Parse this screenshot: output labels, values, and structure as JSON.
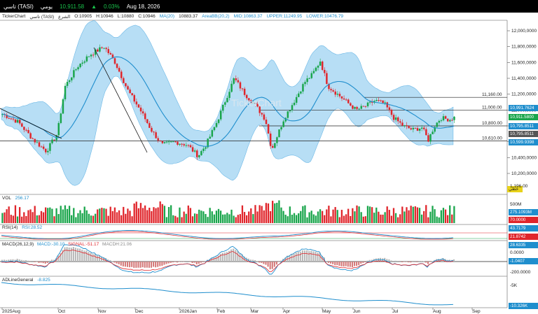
{
  "topbar": {
    "symbol": "تاسي (TASI)",
    "market": "يومي",
    "price": "10,911.58",
    "change_pct": "0.03%",
    "date": "Aug 18, 2026"
  },
  "infobar": {
    "app": "TickerChart",
    "symbol": "تاسي (TASI)",
    "type": "الشرع",
    "open": "O:10905",
    "high": "H:10946",
    "low": "L:10880",
    "close": "C:10946",
    "ma": "MA(20)",
    "ma_val": "10883.37",
    "bb": "AreaBB(20,2)",
    "bb_mid": "MID:10863.37",
    "bb_upper": "UPPER:11249.95",
    "bb_lower": "LOWER:10476.79"
  },
  "price_axis": {
    "ticks": [
      "12,000,0000",
      "11,800,0000",
      "11,600,0000",
      "11,400,0000",
      "11,200,0000",
      "11,000,0000",
      "10,800,0000",
      "10,600,0000",
      "10,400,0000",
      "10,200,0000"
    ],
    "bottom_value": "1,196.00"
  },
  "levels": [
    {
      "label": "11,160.00",
      "value": 11160
    },
    {
      "label": "11,000.00",
      "value": 11000
    },
    {
      "label": "10,800.00",
      "value": 10800
    },
    {
      "label": "10,610.00",
      "value": 10610
    }
  ],
  "price_tags": [
    {
      "text": "10,991.7624",
      "color": "#1f8ecd"
    },
    {
      "text": "10,911.5800",
      "color": "#19a54b"
    },
    {
      "text": "10,795.8511",
      "color": "#1f8ecd"
    },
    {
      "text": "10,795.8511",
      "color": "#555555"
    },
    {
      "text": "10,599.9398",
      "color": "#1f8ecd"
    }
  ],
  "last_label_box": "خطي",
  "volume": {
    "label": "VOL",
    "value": "256.17",
    "axis_top": "500M",
    "tag1": "275.1093M",
    "tag2": "70.0000"
  },
  "rsi": {
    "label": "RSI(14)",
    "value": "RSI:28.52",
    "tag1": "43.7179",
    "tag2": "21.8742",
    "tag3": "28.6335"
  },
  "macd": {
    "label": "MACD(26,12,9)",
    "macd": "MACD:-30.10",
    "signal": "SIGNAL:-51.17",
    "hist": "MACDH:21.06",
    "tag1": "0.0000",
    "tag2": "-1.0407",
    "axis_bottom": "-200.0000"
  },
  "adline": {
    "label": "ADLineGeneral",
    "value": "-8.825",
    "axis_top": "-5K",
    "tag": "-10.326K"
  },
  "x_axis": [
    "2025Aug",
    "Oct",
    "Nov",
    "Dec",
    "2026Jan",
    "Feb",
    "Mar",
    "Apr",
    "May",
    "Jun",
    "Jul",
    "Aug",
    "Sep"
  ],
  "colors": {
    "up": "#19a54b",
    "down": "#e0252b",
    "band": "#9fd3f2",
    "ma": "#1f8ecd"
  },
  "watermark": "TickerChart"
}
